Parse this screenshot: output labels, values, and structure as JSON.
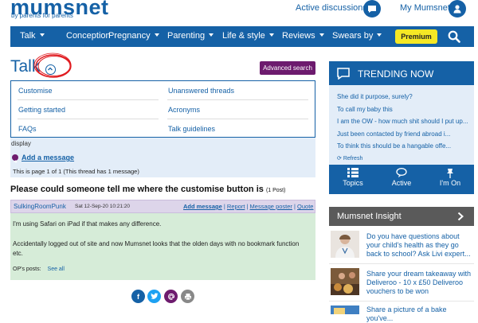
{
  "header": {
    "logo": "mumsnet",
    "logo_sub": "by parents for parents",
    "active_discussions": "Active discussions",
    "my_mumsnet": "My Mumsnet"
  },
  "nav": {
    "items": [
      "Talk",
      "Conception",
      "Pregnancy",
      "Parenting",
      "Life & style",
      "Reviews",
      "Swears by"
    ],
    "premium": "Premium"
  },
  "page": {
    "title": "Talk",
    "advanced_search": "Advanced search"
  },
  "dropdown": {
    "items": [
      "Customise",
      "Unanswered threads",
      "Getting started",
      "Acronyms",
      "FAQs",
      "Talk guidelines"
    ]
  },
  "thread_panel": {
    "display": "display",
    "add_message": "Add a message",
    "page_info": "This is page 1 of 1 (This thread has 1 message)"
  },
  "thread": {
    "title": "Please could someone tell me where the customise button is",
    "post_count": "(1 Post)",
    "poster": "SulkingRoomPunk",
    "date": "Sat 12-Sep-20 10:21:20",
    "actions": [
      "Add message",
      "Report",
      "Message poster",
      "Quote"
    ],
    "body_p1": "I'm using Safari on iPad if that makes any difference.",
    "body_p2": "Accidentally logged out of site and now Mumsnet looks that the olden days with no bookmark function etc.",
    "ops_posts": "OP's posts:",
    "see_all": "See all"
  },
  "trending": {
    "title": "TRENDING NOW",
    "items": [
      "She did it purpose, surely?",
      "To call my baby this",
      "I am the OW - how much shit should I put up...",
      "Just been contacted by friend abroad i...",
      "To think this should be a hangable offe..."
    ],
    "refresh": "Refresh",
    "tabs": [
      "Topics",
      "Active",
      "I'm On"
    ]
  },
  "insight": {
    "title": "Mumsnet Insight",
    "items": [
      "Do you have questions about your child's health as they go back to school? Ask Livi expert...",
      "Share your dream takeaway with Deliveroo - 10 x £50 Deliveroo vouchers to be won",
      "Share a picture of a bake you've..."
    ]
  },
  "colors": {
    "brand_blue": "#1561a6",
    "premium_yellow": "#f5e825",
    "advanced_purple": "#6d1b6e",
    "post_green": "#d6ecd8",
    "annotation_red": "#e0191e"
  }
}
